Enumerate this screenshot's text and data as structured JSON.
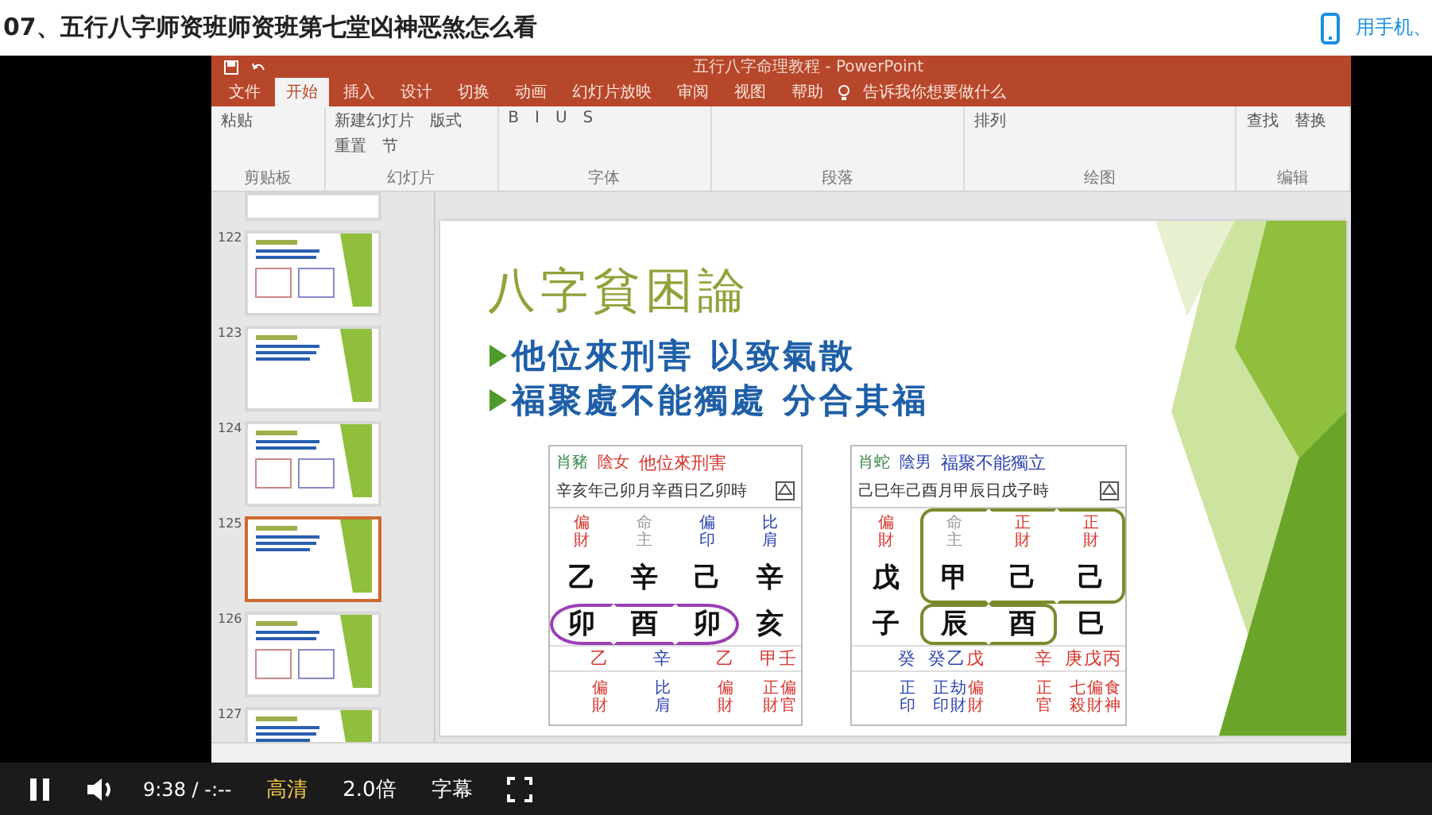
{
  "page_title": "07、五行八字师资班师资班第七堂凶神恶煞怎么看",
  "phone_link": "用手机、",
  "powerpoint": {
    "title": "五行八字命理教程 - PowerPoint",
    "tabs": [
      {
        "label": "文件",
        "selected": false
      },
      {
        "label": "开始",
        "selected": true
      },
      {
        "label": "插入",
        "selected": false
      },
      {
        "label": "设计",
        "selected": false
      },
      {
        "label": "切换",
        "selected": false
      },
      {
        "label": "动画",
        "selected": false
      },
      {
        "label": "幻灯片放映",
        "selected": false
      },
      {
        "label": "审阅",
        "selected": false
      },
      {
        "label": "视图",
        "selected": false
      },
      {
        "label": "帮助",
        "selected": false
      }
    ],
    "tell_me": "告诉我你想要做什么",
    "ribbon_groups": [
      {
        "label": "剪贴板",
        "buttons": [
          "粘贴"
        ]
      },
      {
        "label": "幻灯片",
        "buttons": [
          "新建幻灯片",
          "版式",
          "重置",
          "节"
        ]
      },
      {
        "label": "字体",
        "buttons": [
          "B",
          "I",
          "U",
          "S"
        ]
      },
      {
        "label": "段落"
      },
      {
        "label": "绘图",
        "buttons": [
          "排列"
        ]
      },
      {
        "label": "编辑",
        "buttons": [
          "查找",
          "替换"
        ]
      }
    ],
    "thumbnails": [
      {
        "selected": false
      },
      {
        "number": "122",
        "selected": false
      },
      {
        "number": "123",
        "selected": false
      },
      {
        "number": "124",
        "selected": false
      },
      {
        "number": "125",
        "selected": true
      },
      {
        "number": "126",
        "selected": false
      },
      {
        "number": "127",
        "selected": false
      }
    ],
    "slide": {
      "title": "八字貧困論",
      "bullets": [
        "他位來刑害 以致氣散",
        "福聚處不能獨處 分合其福"
      ],
      "charts": [
        {
          "zodiac": "肖豬",
          "gender": "陰女",
          "heading": "他位來刑害",
          "date": "辛亥年己卯月辛酉日乙卯時",
          "kind": "ellipse",
          "pillars": [
            {
              "god": {
                "text": "偏財",
                "color": "#d9342b"
              },
              "stem": "乙",
              "branch": "卯",
              "stem_circled": false,
              "branch_circled": true,
              "hidden": [
                {
                  "text": "乙",
                  "color": "#d9342b"
                }
              ],
              "hidden_gods": [
                {
                  "text": "偏財",
                  "color": "#d9342b"
                }
              ]
            },
            {
              "god": {
                "text": "命主",
                "color": "#9a9a9a"
              },
              "stem": "辛",
              "branch": "酉",
              "stem_circled": false,
              "branch_circled": true,
              "hidden": [
                {
                  "text": "辛",
                  "color": "#2a3fb0"
                }
              ],
              "hidden_gods": [
                {
                  "text": "比肩",
                  "color": "#2a3fb0"
                }
              ]
            },
            {
              "god": {
                "text": "偏印",
                "color": "#2a3fb0"
              },
              "stem": "己",
              "branch": "卯",
              "stem_circled": false,
              "branch_circled": true,
              "hidden": [
                {
                  "text": "乙",
                  "color": "#d9342b"
                }
              ],
              "hidden_gods": [
                {
                  "text": "偏財",
                  "color": "#d9342b"
                }
              ]
            },
            {
              "god": {
                "text": "比肩",
                "color": "#2a3fb0"
              },
              "stem": "辛",
              "branch": "亥",
              "stem_circled": false,
              "branch_circled": false,
              "hidden": [
                {
                  "text": "甲",
                  "color": "#d9342b"
                },
                {
                  "text": "壬",
                  "color": "#d9342b"
                }
              ],
              "hidden_gods": [
                {
                  "text": "正財",
                  "color": "#d9342b"
                },
                {
                  "text": "偏官",
                  "color": "#d9342b"
                }
              ]
            }
          ]
        },
        {
          "zodiac": "肖蛇",
          "gender": "陰男",
          "heading": "福聚不能獨立",
          "date": "己巳年己酉月甲辰日戊子時",
          "kind": "box",
          "pillars": [
            {
              "god": {
                "text": "偏財",
                "color": "#d9342b"
              },
              "stem": "戊",
              "branch": "子",
              "stem_circled": false,
              "branch_circled": false,
              "hidden": [
                {
                  "text": "癸",
                  "color": "#2a3fb0"
                }
              ],
              "hidden_gods": [
                {
                  "text": "正印",
                  "color": "#2a3fb0"
                }
              ]
            },
            {
              "god": {
                "text": "命主",
                "color": "#9a9a9a"
              },
              "stem": "甲",
              "branch": "辰",
              "stem_circled": true,
              "branch_circled": true,
              "hidden": [
                {
                  "text": "癸",
                  "color": "#2a3fb0"
                },
                {
                  "text": "乙",
                  "color": "#2a3fb0"
                },
                {
                  "text": "戊",
                  "color": "#d9342b"
                }
              ],
              "hidden_gods": [
                {
                  "text": "正印",
                  "color": "#2a3fb0"
                },
                {
                  "text": "劫財",
                  "color": "#2a3fb0"
                },
                {
                  "text": "偏財",
                  "color": "#d9342b"
                }
              ]
            },
            {
              "god": {
                "text": "正財",
                "color": "#d9342b"
              },
              "stem": "己",
              "branch": "酉",
              "stem_circled": true,
              "branch_circled": true,
              "hidden": [
                {
                  "text": "辛",
                  "color": "#d9342b"
                }
              ],
              "hidden_gods": [
                {
                  "text": "正官",
                  "color": "#d9342b"
                }
              ]
            },
            {
              "god": {
                "text": "正財",
                "color": "#d9342b"
              },
              "stem": "己",
              "branch": "巳",
              "stem_circled": true,
              "branch_circled": false,
              "hidden": [
                {
                  "text": "庚",
                  "color": "#d9342b"
                },
                {
                  "text": "戊",
                  "color": "#d9342b"
                },
                {
                  "text": "丙",
                  "color": "#d9342b"
                }
              ],
              "hidden_gods": [
                {
                  "text": "七殺",
                  "color": "#d9342b"
                },
                {
                  "text": "偏財",
                  "color": "#d9342b"
                },
                {
                  "text": "食神",
                  "color": "#d9342b"
                }
              ]
            }
          ]
        }
      ]
    }
  },
  "player": {
    "playing": true,
    "time": "9:38 / -:--",
    "quality": "高清",
    "speed": "2.0倍",
    "subtitles": "字幕"
  }
}
